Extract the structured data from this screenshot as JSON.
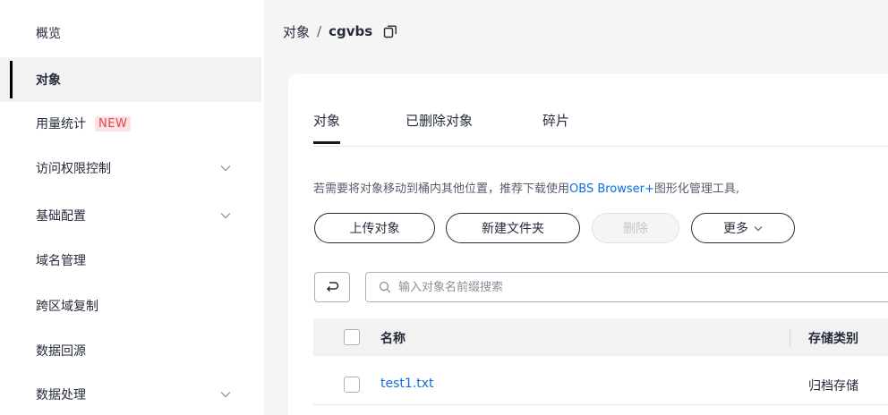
{
  "sidebar": {
    "items": [
      {
        "label": "概览"
      },
      {
        "label": "对象"
      },
      {
        "label": "用量统计",
        "badge": "NEW"
      },
      {
        "label": "访问权限控制"
      },
      {
        "label": "基础配置"
      },
      {
        "label": "域名管理"
      },
      {
        "label": "跨区域复制"
      },
      {
        "label": "数据回源"
      },
      {
        "label": "数据处理"
      }
    ],
    "active_index": 1,
    "badge_color": "#e64552",
    "chevron_icon": "chevron-down-icon"
  },
  "breadcrumb": {
    "parent": "对象",
    "separator": "/",
    "bucket": "cgvbs",
    "copy_icon": "copy-icon"
  },
  "tabs": [
    {
      "label": "对象"
    },
    {
      "label": "已删除对象"
    },
    {
      "label": "碎片"
    }
  ],
  "hint": {
    "prefix": "若需要将对象移动到桶内其他位置，推荐下载使用",
    "link": "OBS Browser+",
    "suffix": "图形化管理工具,"
  },
  "toolbar": {
    "upload_label": "上传对象",
    "new_folder_label": "新建文件夹",
    "delete_label": "删除",
    "more_label": "更多"
  },
  "search": {
    "placeholder": "输入对象名前缀搜索",
    "value": ""
  },
  "table": {
    "columns": [
      "名称",
      "存储类别"
    ],
    "rows": [
      {
        "name": "test1.txt",
        "storage_class": "归档存储"
      }
    ]
  },
  "colors": {
    "accent": "#0d6ee0",
    "text": "#252b3a"
  }
}
